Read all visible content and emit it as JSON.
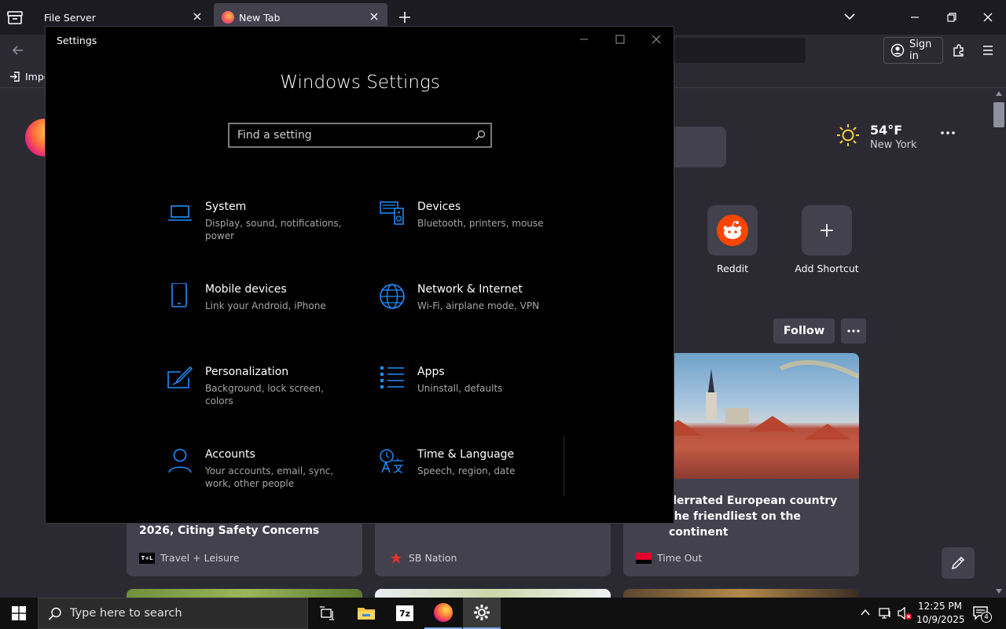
{
  "browser": {
    "tabs": [
      {
        "label": "File Server"
      },
      {
        "label": "New Tab"
      }
    ],
    "sign_in_label": "Sign in",
    "bookmarks_import_label": "Impo"
  },
  "newtab": {
    "weather": {
      "temp": "54°F",
      "city": "New York"
    },
    "shortcuts": [
      {
        "label": "Reddit"
      },
      {
        "label": "Add Shortcut"
      }
    ],
    "follow_label": "Follow",
    "feed_cards": [
      {
        "headline": "2026, Citing Safety Concerns",
        "source": "Travel + Leisure"
      },
      {
        "headline": "",
        "source": "SB Nation"
      },
      {
        "headline_line1": "derrated European country",
        "headline_line2": "the friendliest on the continent",
        "source": "Time Out"
      }
    ]
  },
  "settings": {
    "window_title": "Settings",
    "heading": "Windows Settings",
    "search_placeholder": "Find a setting",
    "items": [
      {
        "title": "System",
        "subtitle": "Display, sound, notifications, power",
        "icon": "laptop-icon"
      },
      {
        "title": "Devices",
        "subtitle": "Bluetooth, printers, mouse",
        "icon": "devices-icon"
      },
      {
        "title": "Mobile devices",
        "subtitle": "Link your Android, iPhone",
        "icon": "phone-icon"
      },
      {
        "title": "Network & Internet",
        "subtitle": "Wi-Fi, airplane mode, VPN",
        "icon": "globe-icon"
      },
      {
        "title": "Personalization",
        "subtitle": "Background, lock screen, colors",
        "icon": "paint-icon"
      },
      {
        "title": "Apps",
        "subtitle": "Uninstall, defaults",
        "icon": "apps-list-icon"
      },
      {
        "title": "Accounts",
        "subtitle": "Your accounts, email, sync, work, other people",
        "icon": "person-icon"
      },
      {
        "title": "Time & Language",
        "subtitle": "Speech, region, date",
        "icon": "time-language-icon"
      }
    ],
    "accent_color": "#1f8fff"
  },
  "taskbar": {
    "search_placeholder": "Type here to search",
    "clock_time": "12:25 PM",
    "clock_date": "10/9/2025",
    "notification_count": "4"
  }
}
